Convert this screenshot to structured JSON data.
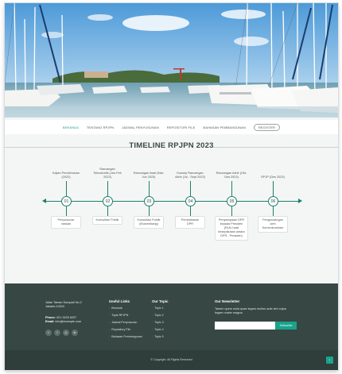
{
  "nav": {
    "items": [
      "BERANDA",
      "TENTANG RPJPN",
      "JADWAL PENYUSUNAN",
      "REPOSITORI FILE",
      "BAHASAN PEMBANGUNAN",
      "REGISTER"
    ],
    "active_index": 0
  },
  "section": {
    "title": "TIMELINE RPJPN 2023"
  },
  "timeline": [
    {
      "num": "01",
      "top": "Kajian Pendahuluan\n(2022)",
      "bottom": "Penyusunan naskah"
    },
    {
      "num": "02",
      "top": "Rancangan\nTeknokratik (Jan-Feb\n2023)",
      "bottom": "Konsultasi Publik"
    },
    {
      "num": "03",
      "top": "Rancangan Awal (Mar-\nJun 2023)",
      "bottom": "Konsultasi Publik\n(Musrenbang)"
    },
    {
      "num": "04",
      "top": "Konsep Rancangan\nAkhir (Jul - Sept 2023)",
      "bottom": "Pembahasan DPR"
    },
    {
      "num": "05",
      "top": "Rancangan Akhir (Okt-\nDes 2023)",
      "bottom": "Penyampaian DPR\nkepada Presiden\n(RUU hasil\nkesepakatan antara\nDPR - Presiden)"
    },
    {
      "num": "06",
      "top": "RPJP (Des 2023)",
      "bottom": "Pengundangan oleh\nKemenkumham"
    }
  ],
  "footer": {
    "address": [
      "Jalan Taman Suropati No.2",
      "Jakarta 10310"
    ],
    "phone_label": "Phone:",
    "phone": "021 3193 6207",
    "email_label": "Email:",
    "email": "info@example.com",
    "social_icons": [
      "twitter-icon",
      "facebook-icon",
      "instagram-icon",
      "linkedin-icon"
    ],
    "useful_links_title": "Useful Links",
    "useful_links": [
      "Beranda",
      "Topik RPJPN",
      "Jadwal Penyusunan",
      "Repository File",
      "Bahasan Pembangunan"
    ],
    "topic_title": "Our Topic",
    "topics": [
      "Topic 1",
      "Topic 2",
      "Topic 3",
      "Topic 4",
      "Topic 5"
    ],
    "newsletter_title": "Our Newsletter",
    "newsletter_text": "Tamen quem nulla quae legam multos aute sint culpa legam noster magna",
    "subscribe_label": "Subscribe",
    "copyright": "© Copyright. All Rights Reserved"
  },
  "colors": {
    "accent": "#1aa38a",
    "footer_bg": "#374744",
    "footer_bottom": "#2f3d3b",
    "timeline": "#1e7f6d"
  }
}
